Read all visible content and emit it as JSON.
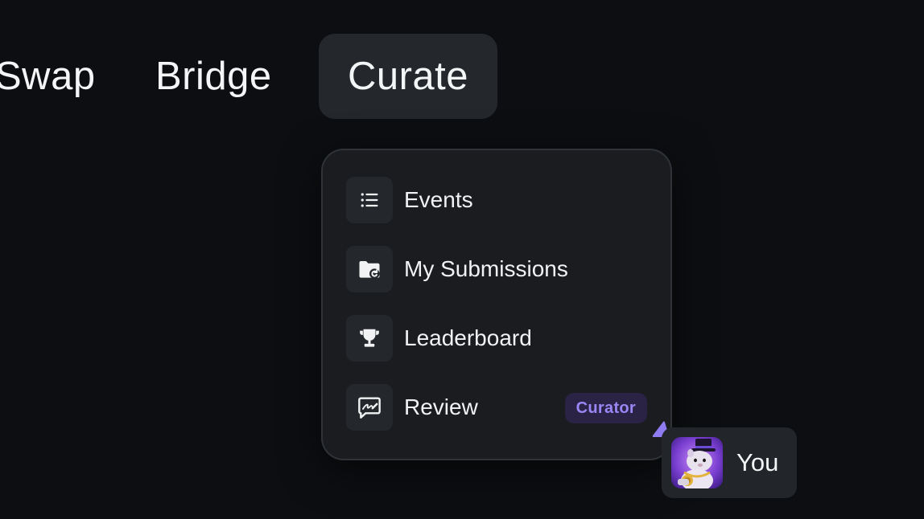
{
  "nav": {
    "items": [
      {
        "label": "Swap"
      },
      {
        "label": "Bridge"
      },
      {
        "label": "Curate",
        "active": true
      }
    ]
  },
  "curate_menu": {
    "items": [
      {
        "label": "Events",
        "icon": "list-icon"
      },
      {
        "label": "My Submissions",
        "icon": "folder-upload-icon"
      },
      {
        "label": "Leaderboard",
        "icon": "trophy-icon"
      },
      {
        "label": "Review",
        "icon": "review-signature-icon",
        "badge": "Curator"
      }
    ]
  },
  "user_cursor": {
    "label": "You",
    "avatar": "hamster-top-hat-avatar",
    "cursor_color": "#8f7cf3"
  },
  "colors": {
    "background": "#0c0e11",
    "menu_background": "#1a1c20",
    "active_tab": "#24282d",
    "badge_text": "#9b86f5",
    "badge_background": "#2a2346"
  }
}
